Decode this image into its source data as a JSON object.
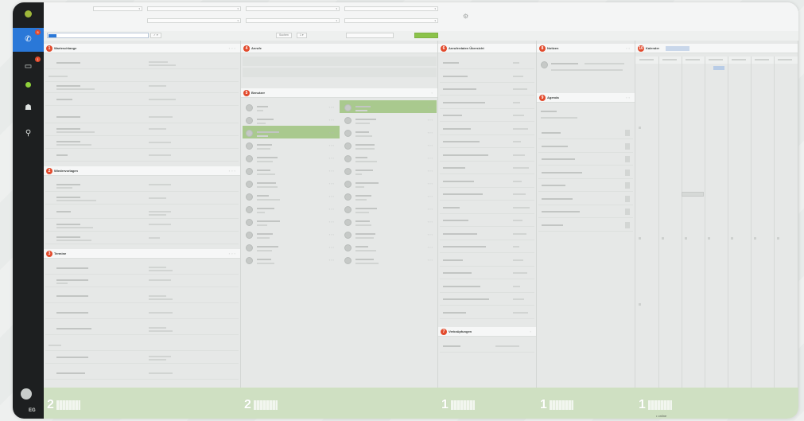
{
  "rail": {
    "items": [
      {
        "label": "",
        "icon": "phone-icon",
        "badge": "",
        "active": true
      },
      {
        "label": "",
        "icon": "monitor-icon",
        "badge": "",
        "active": false
      },
      {
        "label": "",
        "icon": "status-dot-icon",
        "badge": "",
        "active": false
      },
      {
        "label": "",
        "icon": "people-icon",
        "badge": "",
        "active": false
      },
      {
        "label": "",
        "icon": "pin-icon",
        "badge": "",
        "active": false
      }
    ],
    "brand": "EG"
  },
  "columns": [
    {
      "panels": [
        {
          "num": "1",
          "title": "Warteschlange"
        },
        {
          "num": "2",
          "title": "Wiedervorlagen"
        },
        {
          "num": "3",
          "title": "Termine"
        }
      ],
      "footer_count": "2"
    },
    {
      "panels": [
        {
          "num": "4",
          "title": "Anrufe"
        },
        {
          "num": "5",
          "title": "Benutzer"
        }
      ],
      "footer_count": "2"
    },
    {
      "panels": [
        {
          "num": "6",
          "title": "Anruferdaten Übersicht"
        },
        {
          "num": "7",
          "title": "Verknüpfungen"
        }
      ],
      "footer_count": "1"
    },
    {
      "panels": [
        {
          "num": "8",
          "title": "Notizen"
        },
        {
          "num": "9",
          "title": "Agenda"
        }
      ],
      "footer_count": "1"
    },
    {
      "panels": [
        {
          "num": "10",
          "title": "Kalender"
        }
      ],
      "footer_count": "1"
    }
  ],
  "search": {
    "placeholder": "",
    "button_label": "Suchen"
  },
  "footer": {
    "note": "• online"
  },
  "colors": {
    "accent": "#2a78d8",
    "badge": "#e24a2c",
    "highlight": "#a9c98e",
    "footer": "#cfe0c2"
  }
}
